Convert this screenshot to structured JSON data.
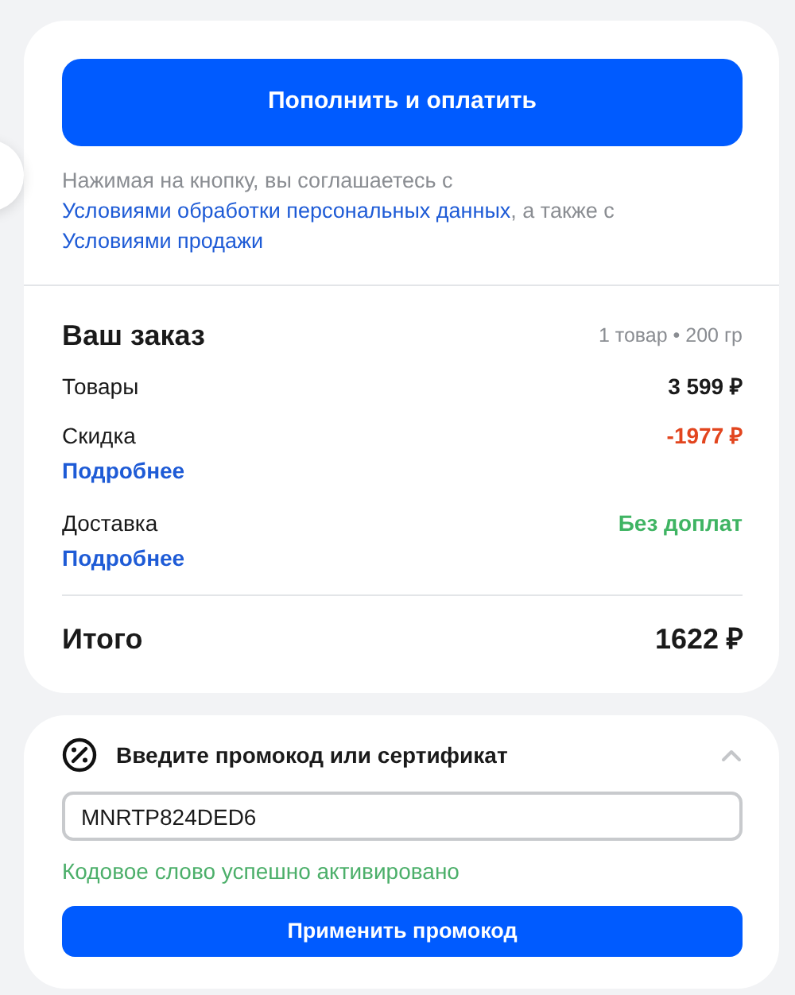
{
  "pay_button": "Пополнить и оплатить",
  "consent": [
    {
      "kind": "text",
      "text": "Нажимая на кнопку, вы соглашаетесь с "
    },
    {
      "kind": "link",
      "text": "Условиями обработки персональных данных"
    },
    {
      "kind": "text",
      "text": ", а также с "
    },
    {
      "kind": "link",
      "text": "Условиями продажи"
    }
  ],
  "order": {
    "title": "Ваш заказ",
    "summary": "1 товар • 200 гр",
    "rows": [
      {
        "label": "Товары",
        "value": "3 599 ₽",
        "kind": "normal"
      },
      {
        "label": "Скидка",
        "value": "-1977 ₽",
        "kind": "discount",
        "link": "Подробнее"
      },
      {
        "label": "Доставка",
        "value": "Без доплат",
        "kind": "free",
        "link": "Подробнее"
      }
    ],
    "total_label": "Итого",
    "total_value": "1622 ₽"
  },
  "promo": {
    "title": "Введите промокод или сертификат",
    "expanded": true,
    "value": "MNRTP824DED6",
    "message": "Кодовое слово успешно активировано",
    "button": "Применить промокод"
  }
}
